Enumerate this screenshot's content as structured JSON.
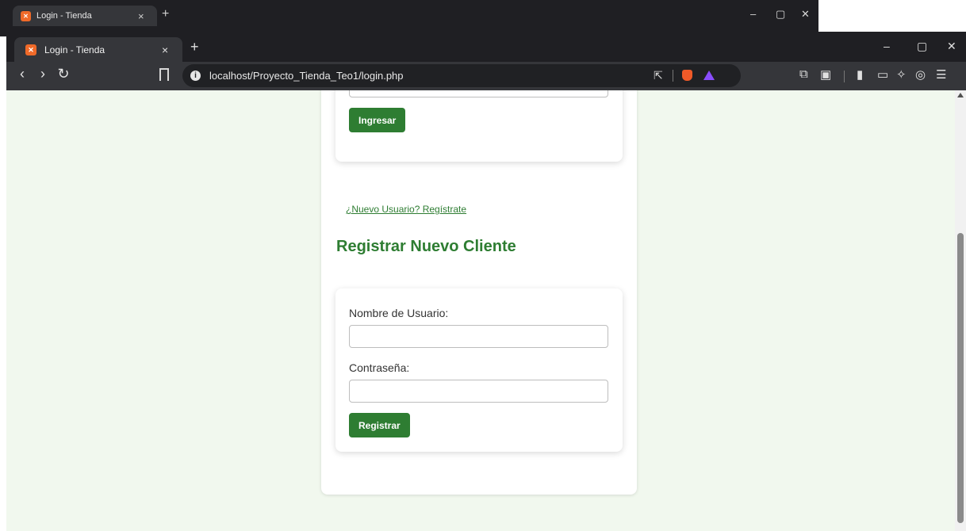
{
  "background_window": {
    "tab_title": "Login - Tienda",
    "close": "×",
    "new_tab": "+",
    "minimize": "–",
    "restore": "▢",
    "close_window": "✕"
  },
  "browser": {
    "tab_title": "Login - Tienda",
    "tab_close": "×",
    "new_tab": "+",
    "minimize": "–",
    "restore": "▢",
    "close_window": "✕",
    "back": "‹",
    "forward": "›",
    "reload": "↻",
    "url": "localhost/Proyecto_Tienda_Teo1/login.php",
    "toolbar_icons": [
      "extensions-icon",
      "screenshot-icon",
      "sidebar-icon",
      "wallet-icon",
      "leo-ai-icon",
      "vpn-icon",
      "menu-icon"
    ]
  },
  "login": {
    "submit_label": "Ingresar"
  },
  "register_link": "¿Nuevo Usuario? Regístrate",
  "register": {
    "heading": "Registrar Nuevo Cliente",
    "username_label": "Nombre de Usuario:",
    "password_label": "Contraseña:",
    "submit_label": "Registrar"
  },
  "colors": {
    "accent": "#2e7d32",
    "page_background": "#f1f8ee"
  }
}
